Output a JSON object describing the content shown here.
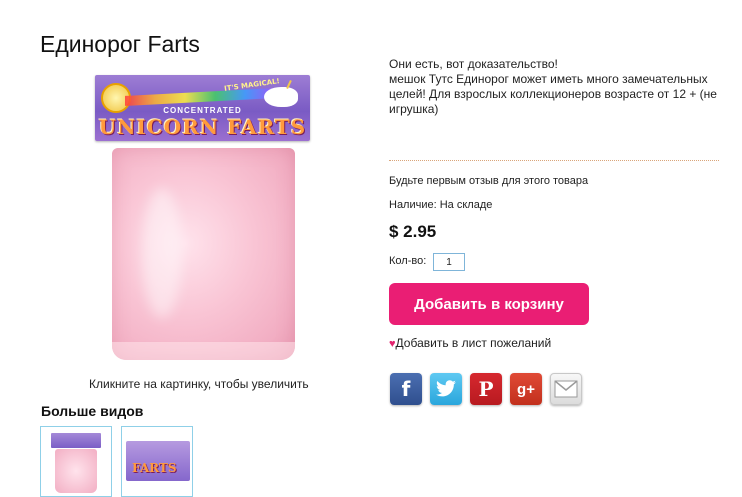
{
  "product": {
    "title": "Единорог Farts",
    "description_line1": "Они есть, вот доказательство!",
    "description_line2": "мешок Тутс Единорог может иметь много замечательных целей! Для взрослых коллекционеров возрасте от 12 + (не игрушка)",
    "review_link": "Будьте первым отзыв для этого товара",
    "availability": "Наличие: На складе",
    "price": "$ 2.95",
    "qty_label": "Кол-во:",
    "qty_value": "1",
    "add_to_cart": "Добавить в корзину",
    "wishlist": "Добавить в лист пожеланий"
  },
  "image": {
    "zoom_hint": "Кликните на картинку, чтобы увеличить",
    "package_badge": "IT'S MAGICAL!",
    "package_subtitle": "CONCENTRATED",
    "package_brand": "UNICORN FARTS"
  },
  "more_views": {
    "heading": "Больше видов"
  },
  "social": [
    "facebook-icon",
    "twitter-icon",
    "pinterest-icon",
    "google-plus-icon",
    "email-icon"
  ],
  "colors": {
    "accent": "#ea1e74",
    "heart": "#e2246e",
    "divider": "#d9a57a",
    "thumb_border": "#8fd0e8"
  }
}
